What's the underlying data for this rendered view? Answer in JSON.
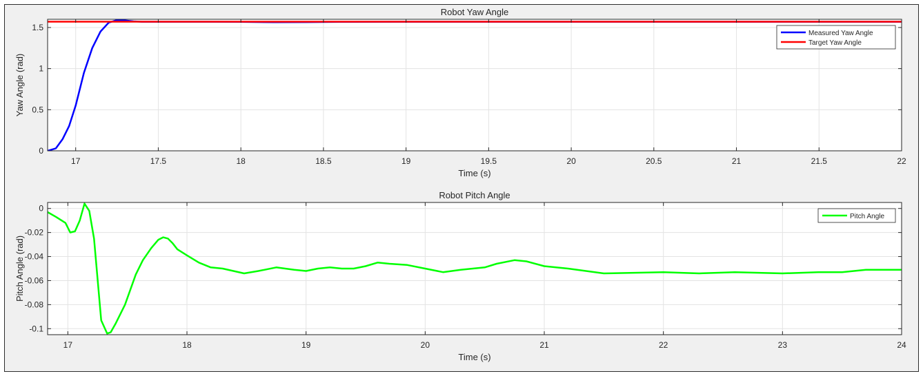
{
  "chart_data": [
    {
      "type": "line",
      "title": "Robot Yaw Angle",
      "xlabel": "Time (s)",
      "ylabel": "Yaw Angle (rad)",
      "xlim": [
        16.83,
        22
      ],
      "ylim": [
        0,
        1.6
      ],
      "xticks": [
        17,
        17.5,
        18,
        18.5,
        19,
        19.5,
        20,
        20.5,
        21,
        21.5,
        22
      ],
      "xtick_labels": [
        "17",
        "17.5",
        "18",
        "18.5",
        "19",
        "19.5",
        "20",
        "20.5",
        "21",
        "21.5",
        "22"
      ],
      "yticks": [
        0,
        0.5,
        1,
        1.5
      ],
      "ytick_labels": [
        "0",
        "0.5",
        "1",
        "1.5"
      ],
      "grid": true,
      "legend_position": "top-right",
      "series": [
        {
          "name": "Measured Yaw Angle",
          "color": "#0000ff",
          "x": [
            16.83,
            16.88,
            16.92,
            16.96,
            17.0,
            17.05,
            17.1,
            17.15,
            17.2,
            17.25,
            17.3,
            17.35,
            17.4,
            17.5,
            17.6,
            17.8,
            18.0,
            18.2,
            18.4,
            18.6,
            19.0,
            20.0,
            21.0,
            22.0
          ],
          "y": [
            0.0,
            0.03,
            0.14,
            0.3,
            0.55,
            0.95,
            1.25,
            1.45,
            1.56,
            1.59,
            1.585,
            1.575,
            1.57,
            1.57,
            1.57,
            1.57,
            1.568,
            1.565,
            1.566,
            1.568,
            1.57,
            1.57,
            1.57,
            1.57
          ]
        },
        {
          "name": "Target Yaw Angle",
          "color": "#ff0000",
          "x": [
            16.83,
            22.0
          ],
          "y": [
            1.5708,
            1.5708
          ]
        }
      ]
    },
    {
      "type": "line",
      "title": "Robot Pitch Angle",
      "xlabel": "Time (s)",
      "ylabel": "Pitch Angle (rad)",
      "xlim": [
        16.83,
        24
      ],
      "ylim": [
        -0.105,
        0.005
      ],
      "xticks": [
        17,
        18,
        19,
        20,
        21,
        22,
        23,
        24
      ],
      "xtick_labels": [
        "17",
        "18",
        "19",
        "20",
        "21",
        "22",
        "23",
        "24"
      ],
      "yticks": [
        0,
        -0.02,
        -0.04,
        -0.06,
        -0.08,
        -0.1
      ],
      "ytick_labels": [
        "0",
        "-0.02",
        "-0.04",
        "-0.06",
        "-0.08",
        "-0.1"
      ],
      "grid": true,
      "legend_position": "top-right",
      "series": [
        {
          "name": "Pitch Angle",
          "color": "#00ff00",
          "x": [
            16.83,
            16.9,
            16.98,
            17.02,
            17.06,
            17.1,
            17.14,
            17.18,
            17.22,
            17.28,
            17.33,
            17.36,
            17.4,
            17.48,
            17.57,
            17.63,
            17.7,
            17.76,
            17.8,
            17.84,
            17.88,
            17.92,
            18.0,
            18.1,
            18.2,
            18.3,
            18.48,
            18.6,
            18.75,
            18.9,
            19.0,
            19.1,
            19.2,
            19.3,
            19.4,
            19.5,
            19.6,
            19.7,
            19.85,
            20.0,
            20.15,
            20.3,
            20.5,
            20.6,
            20.75,
            20.85,
            21.0,
            21.2,
            21.5,
            22.0,
            22.3,
            22.6,
            23.0,
            23.3,
            23.5,
            23.7,
            24.0
          ],
          "y": [
            -0.003,
            -0.007,
            -0.012,
            -0.02,
            -0.019,
            -0.01,
            0.004,
            -0.002,
            -0.025,
            -0.093,
            -0.104,
            -0.103,
            -0.096,
            -0.08,
            -0.055,
            -0.043,
            -0.033,
            -0.026,
            -0.024,
            -0.025,
            -0.029,
            -0.034,
            -0.039,
            -0.045,
            -0.049,
            -0.05,
            -0.054,
            -0.052,
            -0.049,
            -0.051,
            -0.052,
            -0.05,
            -0.049,
            -0.05,
            -0.05,
            -0.048,
            -0.045,
            -0.046,
            -0.047,
            -0.05,
            -0.053,
            -0.051,
            -0.049,
            -0.046,
            -0.043,
            -0.044,
            -0.048,
            -0.05,
            -0.054,
            -0.053,
            -0.054,
            -0.053,
            -0.054,
            -0.053,
            -0.053,
            -0.051,
            -0.051
          ]
        }
      ]
    }
  ]
}
